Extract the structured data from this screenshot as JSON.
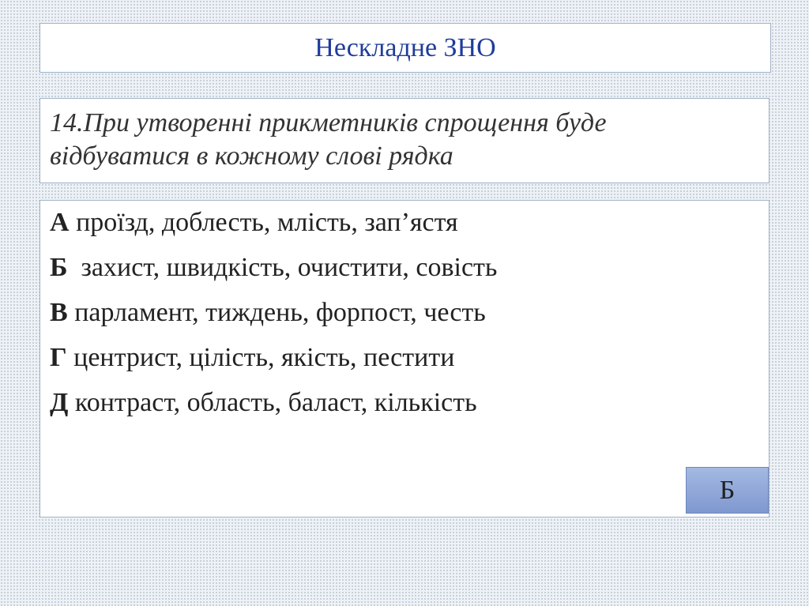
{
  "title": "Нескладне ЗНО",
  "question": {
    "line1": "14.При утворенні прикметників спрощення буде",
    "line2": "відбуватися в кожному слові рядка"
  },
  "options": [
    {
      "letter": "А",
      "text": " проїзд, доблесть, млість, зап’ястя"
    },
    {
      "letter": "Б",
      "text": "  захист, швидкість, очистити, совість"
    },
    {
      "letter": "В",
      "text": " парламент, тиждень, форпост, честь"
    },
    {
      "letter": "Г",
      "text": " центрист, цілість, якість, пестити"
    },
    {
      "letter": "Д",
      "text": " контраст, область, баласт, кількість"
    }
  ],
  "answer": "Б",
  "colors": {
    "title_text": "#1f3c9a",
    "box_border": "#9fb2c8",
    "answer_fill": "#8fa7d8"
  }
}
